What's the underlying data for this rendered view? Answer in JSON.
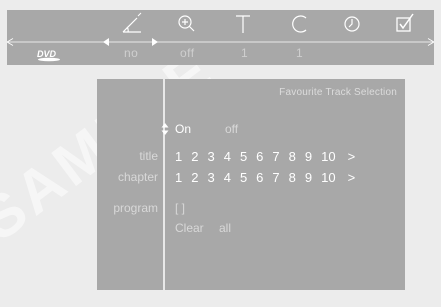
{
  "top_menu": {
    "icons": [
      {
        "name": "angle-icon",
        "value": "no"
      },
      {
        "name": "zoom-icon",
        "value": "off"
      },
      {
        "name": "title-icon",
        "value": "1"
      },
      {
        "name": "chapter-icon",
        "value": "1"
      },
      {
        "name": "time-icon",
        "value": ""
      },
      {
        "name": "checkbox-icon",
        "value": ""
      }
    ],
    "disc_logo": "DVD"
  },
  "panel": {
    "title": "Favourite Track Selection",
    "mode_on": "On",
    "mode_off": "off",
    "title_label": "title",
    "chapter_label": "chapter",
    "program_label": "program",
    "numbers": [
      "1",
      "2",
      "3",
      "4",
      "5",
      "6",
      "7",
      "8",
      "9",
      "10"
    ],
    "more": ">",
    "program_value": "[ ]",
    "clear": "Clear",
    "all": "all"
  },
  "watermark": {
    "text": "SAMPLE"
  }
}
